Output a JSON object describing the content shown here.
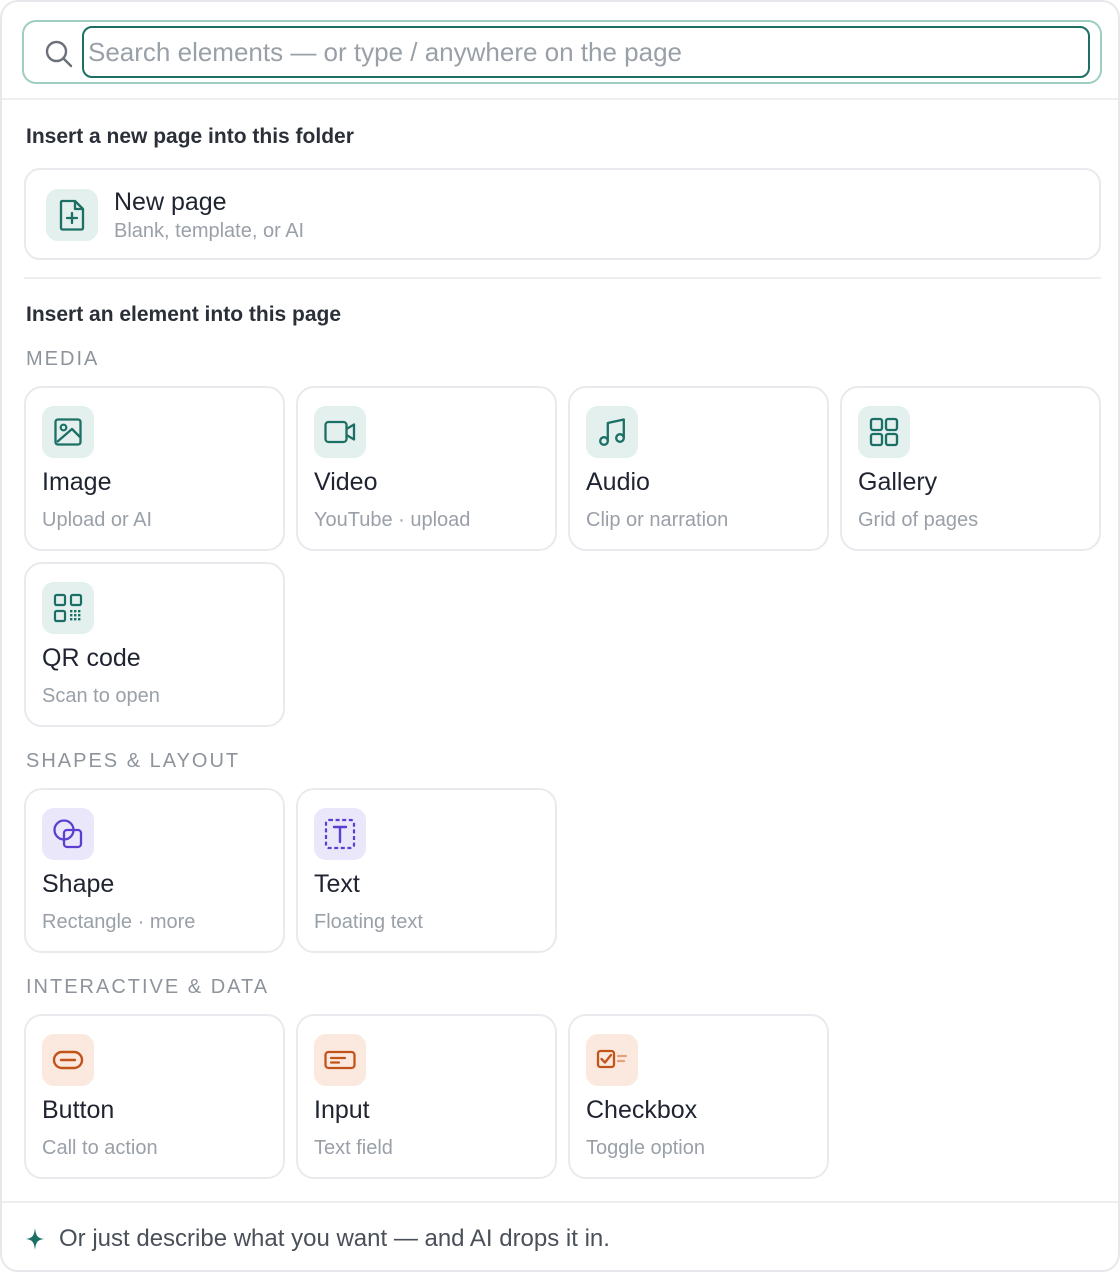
{
  "search": {
    "placeholder": "Search elements — or type / anywhere on the page"
  },
  "folder_section": {
    "title": "Insert a new page into this folder",
    "new_page": {
      "title": "New page",
      "subtitle": "Blank, template, or AI",
      "icon": "file-plus-icon"
    }
  },
  "element_section": {
    "title": "Insert an element into this page",
    "groups": [
      {
        "label": "MEDIA",
        "items": [
          {
            "title": "Image",
            "subtitle": "Upload or AI",
            "icon": "image-icon"
          },
          {
            "title": "Video",
            "subtitle": "YouTube · upload",
            "icon": "video-icon"
          },
          {
            "title": "Audio",
            "subtitle": "Clip or narration",
            "icon": "music-note-icon"
          },
          {
            "title": "Gallery",
            "subtitle": "Grid of pages",
            "icon": "grid-icon"
          },
          {
            "title": "QR code",
            "subtitle": "Scan to open",
            "icon": "qr-code-icon"
          }
        ]
      },
      {
        "label": "SHAPES & LAYOUT",
        "items": [
          {
            "title": "Shape",
            "subtitle": "Rectangle · more",
            "icon": "shapes-icon"
          },
          {
            "title": "Text",
            "subtitle": "Floating text",
            "icon": "text-box-icon"
          }
        ]
      },
      {
        "label": "INTERACTIVE & DATA",
        "items": [
          {
            "title": "Button",
            "subtitle": "Call to action",
            "icon": "button-icon"
          },
          {
            "title": "Input",
            "subtitle": "Text field",
            "icon": "input-field-icon"
          },
          {
            "title": "Checkbox",
            "subtitle": "Toggle option",
            "icon": "checkbox-icon"
          }
        ]
      }
    ]
  },
  "footer": {
    "text": "Or just describe what you want — and AI drops it in.",
    "icon": "sparkle-icon"
  },
  "colors": {
    "accent": "#1c6f64",
    "teal_tile": "#e3f0ed",
    "purple_tile": "#ebe7fb",
    "purple_icon": "#5b3fd0",
    "orange_tile": "#fbe9df",
    "orange_icon": "#c2541a"
  }
}
